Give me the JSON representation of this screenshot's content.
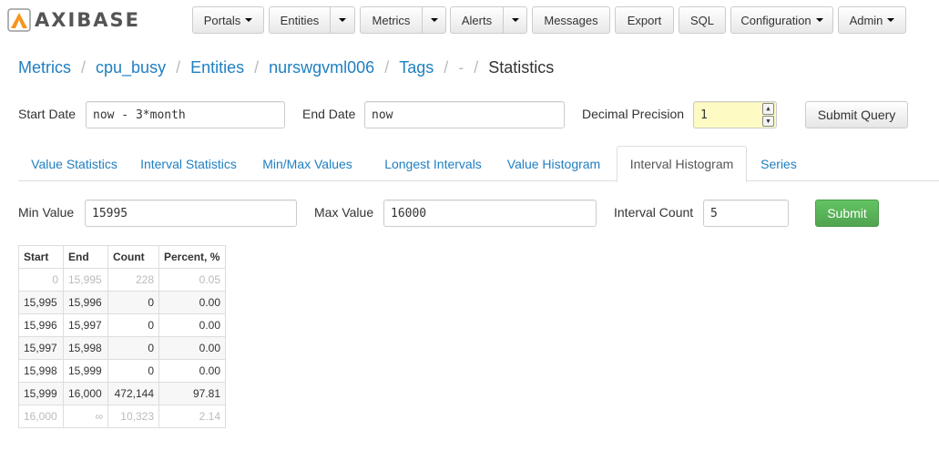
{
  "app": {
    "logo_text": "AXIBASE"
  },
  "nav": {
    "portals": "Portals",
    "entities": "Entities",
    "metrics": "Metrics",
    "alerts": "Alerts",
    "messages": "Messages",
    "export": "Export",
    "sql": "SQL",
    "configuration": "Configuration",
    "admin": "Admin"
  },
  "breadcrumb": {
    "items": [
      "Metrics",
      "cpu_busy",
      "Entities",
      "nurswgvml006",
      "Tags",
      "-",
      "Statistics"
    ],
    "separator": "/"
  },
  "query": {
    "start_label": "Start Date",
    "start_value": "now - 3*month",
    "end_label": "End Date",
    "end_value": "now",
    "precision_label": "Decimal Precision",
    "precision_value": "1",
    "submit_label": "Submit Query"
  },
  "tabs": [
    "Value Statistics",
    "Interval Statistics",
    "Min/Max Values",
    "Longest Intervals",
    "Value Histogram",
    "Interval Histogram",
    "Series"
  ],
  "active_tab": "Interval Histogram",
  "histogram_form": {
    "min_label": "Min Value",
    "min_value": "15995",
    "max_label": "Max Value",
    "max_value": "16000",
    "count_label": "Interval Count",
    "count_value": "5",
    "submit_label": "Submit"
  },
  "table": {
    "headers": [
      "Start",
      "End",
      "Count",
      "Percent, %"
    ],
    "rows": [
      [
        "0",
        "15,995",
        "228",
        "0.05"
      ],
      [
        "15,995",
        "15,996",
        "0",
        "0.00"
      ],
      [
        "15,996",
        "15,997",
        "0",
        "0.00"
      ],
      [
        "15,997",
        "15,998",
        "0",
        "0.00"
      ],
      [
        "15,998",
        "15,999",
        "0",
        "0.00"
      ],
      [
        "15,999",
        "16,000",
        "472,144",
        "97.81"
      ],
      [
        "16,000",
        "∞",
        "10,323",
        "2.14"
      ]
    ]
  },
  "colors": {
    "link": "#1f7fc1",
    "submit_green": "#5bb75b",
    "precision_bg": "#fdfbc3"
  }
}
